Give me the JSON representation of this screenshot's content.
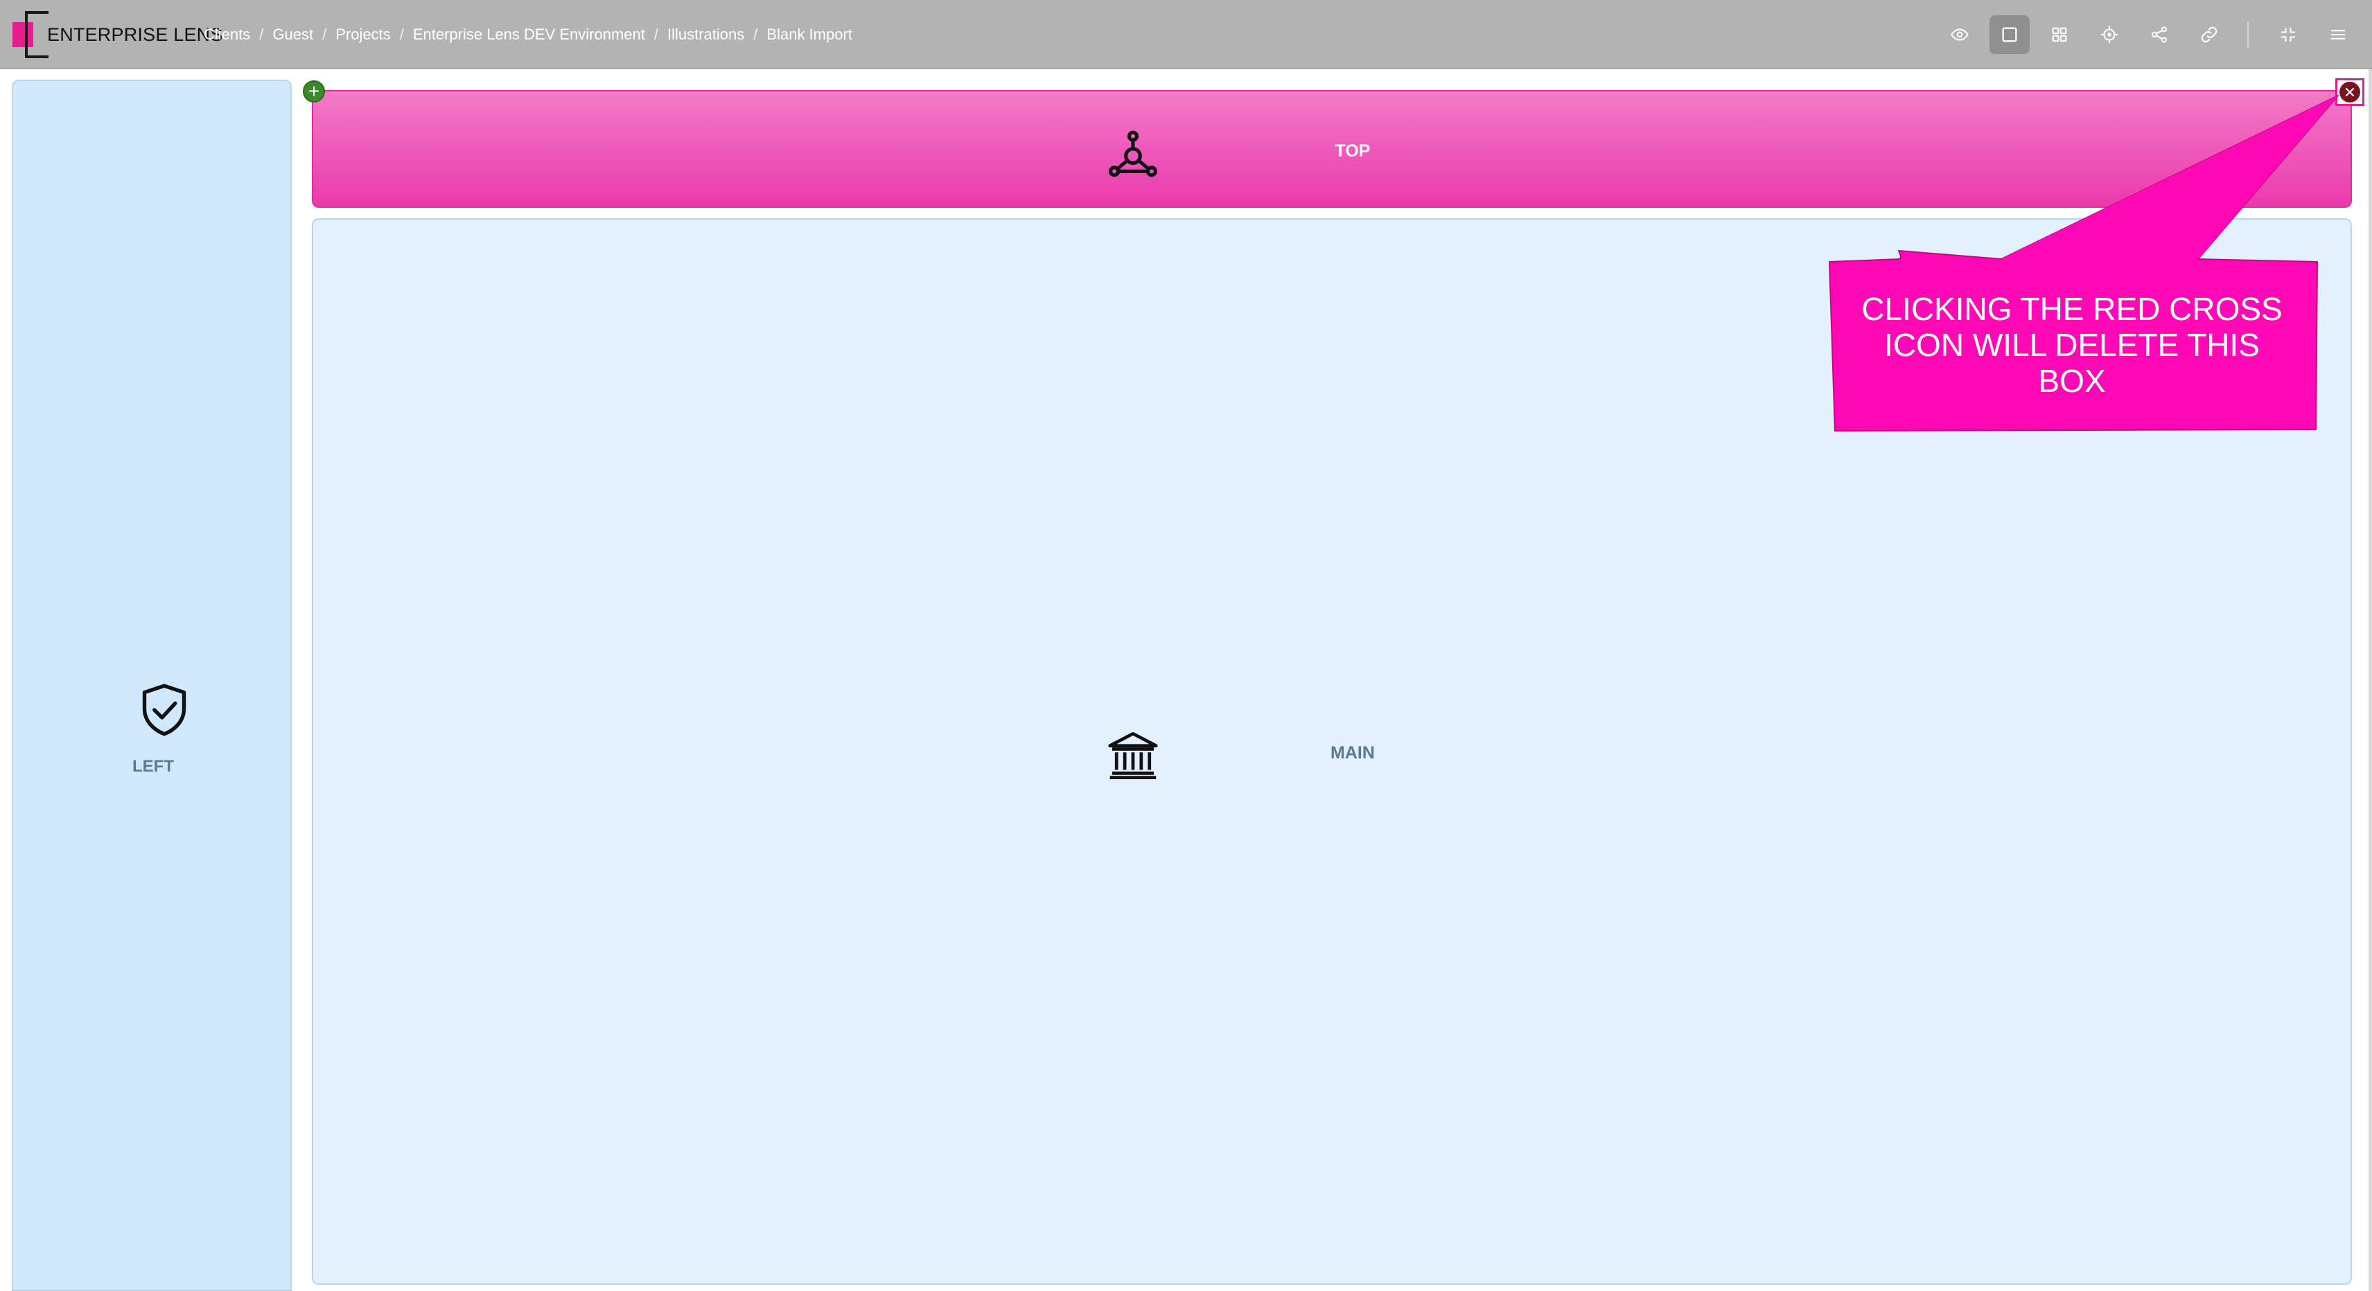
{
  "app": {
    "logo_text": "ENTERPRISE LENS",
    "brand_color": "#e51b8e"
  },
  "breadcrumb": [
    "Clients",
    "Guest",
    "Projects",
    "Enterprise Lens DEV Environment",
    "Illustrations",
    "Blank Import"
  ],
  "breadcrumb_separator": "/",
  "toolbar": {
    "items": [
      {
        "name": "view-icon",
        "active": false
      },
      {
        "name": "square-icon",
        "active": true
      },
      {
        "name": "grid-icon",
        "active": false
      },
      {
        "name": "target-icon",
        "active": false
      },
      {
        "name": "share-icon",
        "active": false
      },
      {
        "name": "link-icon",
        "active": false
      },
      {
        "name": "fullscreen-icon",
        "active": false
      },
      {
        "name": "menu-icon",
        "active": false
      }
    ]
  },
  "canvas": {
    "left": {
      "label": "LEFT",
      "icon": "shield-check-icon",
      "color": "#cfe8fb"
    },
    "top": {
      "label": "TOP",
      "icon": "network-icon",
      "color": "#ea3aac"
    },
    "main": {
      "label": "MAIN",
      "icon": "bank-icon",
      "color": "#e3f0fd"
    },
    "add_button": "+",
    "delete_button_icon": "close-icon"
  },
  "callout": {
    "lines": [
      "CLICKING THE RED CROSS",
      "ICON WILL DELETE THIS",
      "BOX"
    ],
    "color": "#ff08b5"
  }
}
